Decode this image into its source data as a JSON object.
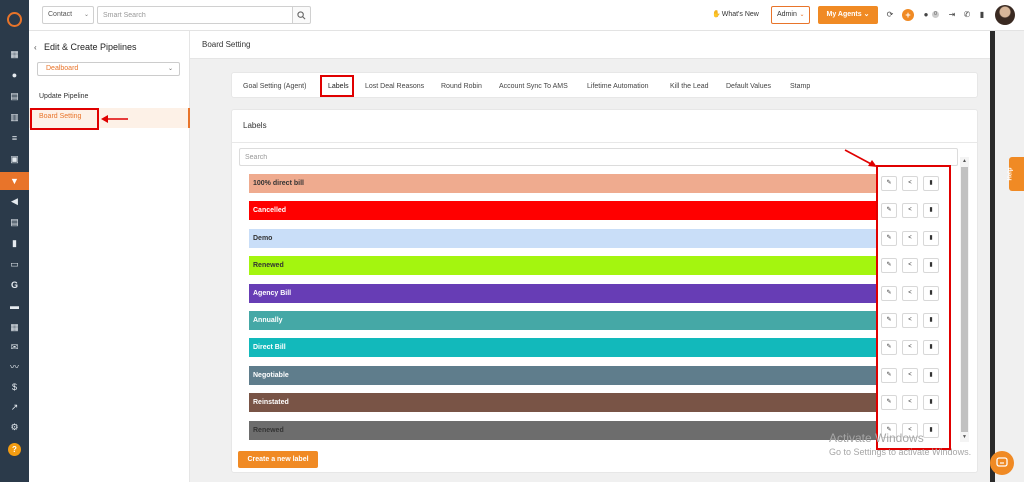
{
  "topbar": {
    "context_select": "Contact",
    "search_placeholder": "Smart Search",
    "whats_new": "What's New",
    "role_select": "Admin",
    "my_agents": "My Agents",
    "plus_icon": "+",
    "notification_count": "0"
  },
  "subnav": {
    "back_icon": "‹",
    "title": "Edit & Create Pipelines",
    "pipeline_select": "Dealboard",
    "items": [
      "Update Pipeline",
      "Board Setting"
    ]
  },
  "header": {
    "title": "Board Setting"
  },
  "tabs": [
    "Goal Setting (Agent)",
    "Labels",
    "Lost Deal Reasons",
    "Round Robin",
    "Account Sync To AMS",
    "Lifetime Automation",
    "Kill the Lead",
    "Default Values",
    "Stamp"
  ],
  "labels_panel": {
    "title": "Labels",
    "search_placeholder": "Search",
    "create_button": "Create a new label",
    "items": [
      {
        "name": "100% direct bill",
        "color": "#efab8f",
        "text_color": "#333333"
      },
      {
        "name": "Cancelled",
        "color": "#ff0000",
        "text_color": "#ffffff"
      },
      {
        "name": "Demo",
        "color": "#c9def8",
        "text_color": "#333333"
      },
      {
        "name": "Renewed",
        "color": "#a4f50f",
        "text_color": "#333333"
      },
      {
        "name": "Agency Bill",
        "color": "#673db5",
        "text_color": "#ffffff"
      },
      {
        "name": "Annually",
        "color": "#45a8a6",
        "text_color": "#ffffff"
      },
      {
        "name": "Direct Bill",
        "color": "#12b9bb",
        "text_color": "#ffffff"
      },
      {
        "name": "Negotiable",
        "color": "#5f7d8c",
        "text_color": "#ffffff"
      },
      {
        "name": "Reinstated",
        "color": "#795446",
        "text_color": "#ffffff"
      },
      {
        "name": "Renewed",
        "color": "#6d6d6d",
        "text_color": "#333333"
      }
    ],
    "row_actions": [
      "edit-icon",
      "share-icon",
      "delete-icon"
    ]
  },
  "watermark": {
    "line1": "Activate Windows",
    "line2": "Go to Settings to activate Windows."
  },
  "help_tab": "Help",
  "colors": {
    "accent": "#f08a24",
    "rail": "#2b3a4a",
    "annotation": "#e00000"
  }
}
